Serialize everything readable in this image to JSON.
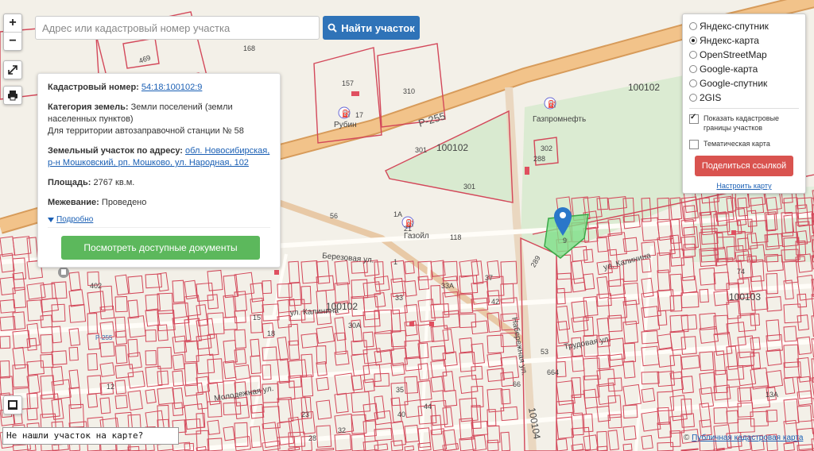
{
  "search": {
    "placeholder": "Адрес или кадастровый номер участка",
    "button_label": "Найти участок"
  },
  "zoom": {
    "in_label": "+",
    "out_label": "−"
  },
  "info": {
    "cadastral_label": "Кадастровый номер:",
    "cadastral_value": "54:18:100102:9",
    "category_label": "Категория земель:",
    "category_value": "Земли поселений (земли населенных пунктов)",
    "purpose_value": "Для территории автозаправочной станции № 58",
    "address_label": "Земельный участок по адресу:",
    "address_value": "обл. Новосибирская, р-н Мошковский, рп. Мошково, ул. Народная, 102",
    "area_label": "Площадь:",
    "area_value": "2767 кв.м.",
    "survey_label": "Межевание:",
    "survey_value": "Проведено",
    "more_label": "Подробно",
    "docs_button": "Посмотреть доступные документы"
  },
  "layers": {
    "options": [
      {
        "label": "Яндекс-спутник",
        "selected": false
      },
      {
        "label": "Яндекс-карта",
        "selected": true
      },
      {
        "label": "OpenStreetMap",
        "selected": false
      },
      {
        "label": "Google-карта",
        "selected": false
      },
      {
        "label": "Google-спутник",
        "selected": false
      },
      {
        "label": "2GIS",
        "selected": false
      }
    ],
    "show_borders_label": "Показать кадастровые границы участков",
    "show_borders_checked": true,
    "thematic_label": "Тематическая карта",
    "thematic_checked": false,
    "share_button": "Поделиться ссылкой",
    "configure_link": "Настроить карту"
  },
  "notfound_label": "Не нашли участок на карте?",
  "attribution": {
    "symbol": "©",
    "link": "Публичная кадастровая карта"
  },
  "map": {
    "labels": {
      "block_100102_a": "100102",
      "block_100102_b": "100102",
      "block_100102_c": "100102",
      "block_100103": "100103",
      "block_100104": "100104",
      "road_r255": "Р-255",
      "station_rubin": "Рубин",
      "station_gazprom": "Газпромнефть",
      "station_gazoil": "Газойл",
      "street_berezovaya": "Березовая ул.",
      "street_kalinina": "ул. Калинина",
      "street_kalinina2": "ул. Калинина",
      "street_trudovaya": "Трудовая ул.",
      "street_molodezhnaya": "Молодежная ул.",
      "street_naberezhnaya": "Набережная ул.",
      "highway_p255": "Р-255",
      "n168": "168",
      "n157": "157",
      "n310": "310",
      "n17": "17",
      "n301a": "301",
      "n301b": "301",
      "n302": "302",
      "n288": "288",
      "n469": "469",
      "n56": "56",
      "n1a": "1А",
      "n21": "21",
      "n118": "118",
      "n1": "1",
      "n37": "37",
      "n33a": "33А",
      "n33": "33",
      "n42": "42",
      "n15": "15",
      "n18": "18",
      "n30a": "30А",
      "n402": "402",
      "n289": "289",
      "n9": "9",
      "n53": "53",
      "n66": "66",
      "n664": "664",
      "n74": "74",
      "n44": "44",
      "n23": "23",
      "n32": "32",
      "n28": "28",
      "n13a": "13А",
      "n40": "40",
      "n35": "35",
      "n12": "12"
    }
  },
  "colors": {
    "parcel_border": "#d3485a",
    "highway_fill": "#f2c38a",
    "highway_edge": "#d79b5a",
    "green_area": "#d8e9cf",
    "selected_parcel": "#7fe08a",
    "marker": "#2a77c9",
    "search_btn": "#2f73b8",
    "docs_btn": "#5cb85c",
    "share_btn": "#d9534f"
  }
}
